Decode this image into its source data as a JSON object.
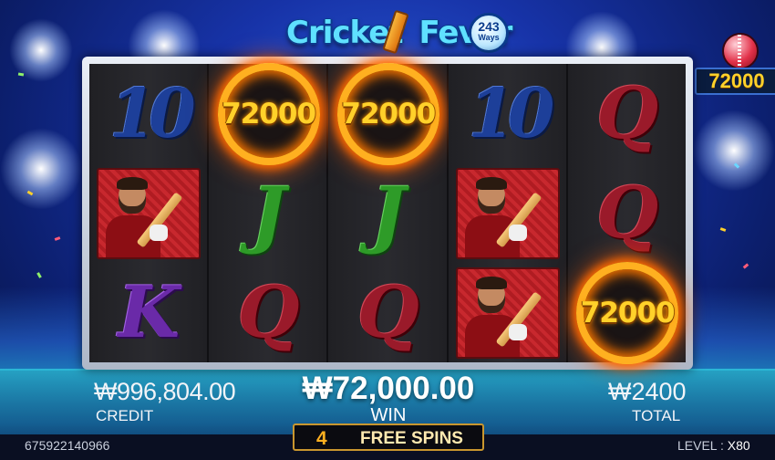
{
  "game": {
    "logo_line1": "Cricket",
    "logo_line2": "Fever",
    "ways_number": "243",
    "ways_label": "Ways"
  },
  "reels": [
    [
      {
        "type": "10",
        "label": "10"
      },
      {
        "type": "player",
        "label": ""
      },
      {
        "type": "k",
        "label": "K"
      }
    ],
    [
      {
        "type": "fire-ball",
        "label": "72000"
      },
      {
        "type": "j",
        "label": "J"
      },
      {
        "type": "q",
        "label": "Q"
      }
    ],
    [
      {
        "type": "fire-ball",
        "label": "72000"
      },
      {
        "type": "j",
        "label": "J"
      },
      {
        "type": "q",
        "label": "Q"
      }
    ],
    [
      {
        "type": "10",
        "label": "10"
      },
      {
        "type": "player",
        "label": ""
      },
      {
        "type": "player",
        "label": ""
      }
    ],
    [
      {
        "type": "q",
        "label": "Q"
      },
      {
        "type": "q",
        "label": "Q"
      },
      {
        "type": "fire-ball",
        "label": "72000"
      }
    ]
  ],
  "jackpot": {
    "value": "72000"
  },
  "credit": {
    "value": "₩996,804.00",
    "label": "CREDIT"
  },
  "win": {
    "value": "₩72,000.00",
    "label": "WIN"
  },
  "total": {
    "value": "₩2400",
    "label": "TOTAL"
  },
  "free_spins": {
    "count": "4",
    "label": "FREE SPINS"
  },
  "session_id": "675922140966",
  "level": {
    "label": "LEVEL :",
    "value": "X80"
  },
  "colors": {
    "accent_gold": "#ffd12a",
    "fire": "#ff6a00",
    "background": "#1733a8"
  }
}
